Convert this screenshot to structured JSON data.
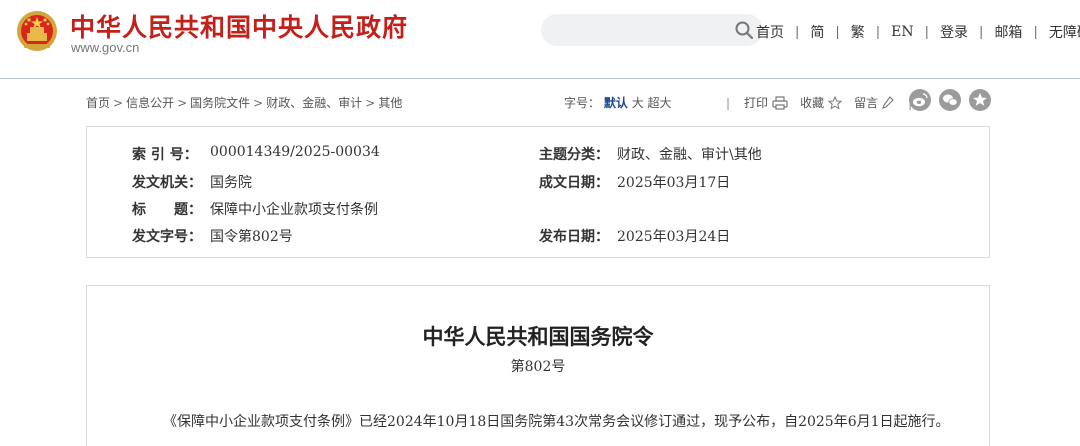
{
  "header": {
    "logo_text": "中华人民共和国中央人民政府",
    "logo_sub": "www.gov.cn",
    "search": {
      "value": "",
      "placeholder": ""
    },
    "nav": [
      "首页",
      "简",
      "繁",
      "EN",
      "登录",
      "邮箱",
      "无障碍"
    ]
  },
  "toolbar": {
    "breadcrumb": [
      "首页",
      "信息公开",
      "国务院文件",
      "财政、金融、审计",
      "其他"
    ],
    "breadcrumb_sep": ">",
    "font_size_label": "字号：",
    "font_sizes": [
      "默认",
      "大",
      "超大"
    ],
    "print_label": "打印",
    "favorite_label": "收藏",
    "comment_label": "留言",
    "divider": "|"
  },
  "meta": {
    "index_label": "索 引 号：",
    "index_value": "000014349/2025-00034",
    "topic_label": "主题分类：",
    "topic_value": "财政、金融、审计\\其他",
    "issuer_label": "发文机关：",
    "issuer_value": "国务院",
    "written_label": "成文日期：",
    "written_value": "2025年03月17日",
    "title_label": "标　　题：",
    "title_value": "保障中小企业款项支付条例",
    "docno_label": "发文字号：",
    "docno_value": "国令第802号",
    "published_label": "发布日期：",
    "published_value": "2025年03月24日"
  },
  "document": {
    "title": "中华人民共和国国务院令",
    "number": "第802号",
    "body": "《保障中小企业款项支付条例》已经2024年10月18日国务院第43次常务会议修订通过，现予公布，自2025年6月1日起施行。"
  },
  "colors": {
    "brand_red": "#c4201a",
    "active_blue": "#1b4a8c",
    "share_gray": "#9b9b9b"
  }
}
